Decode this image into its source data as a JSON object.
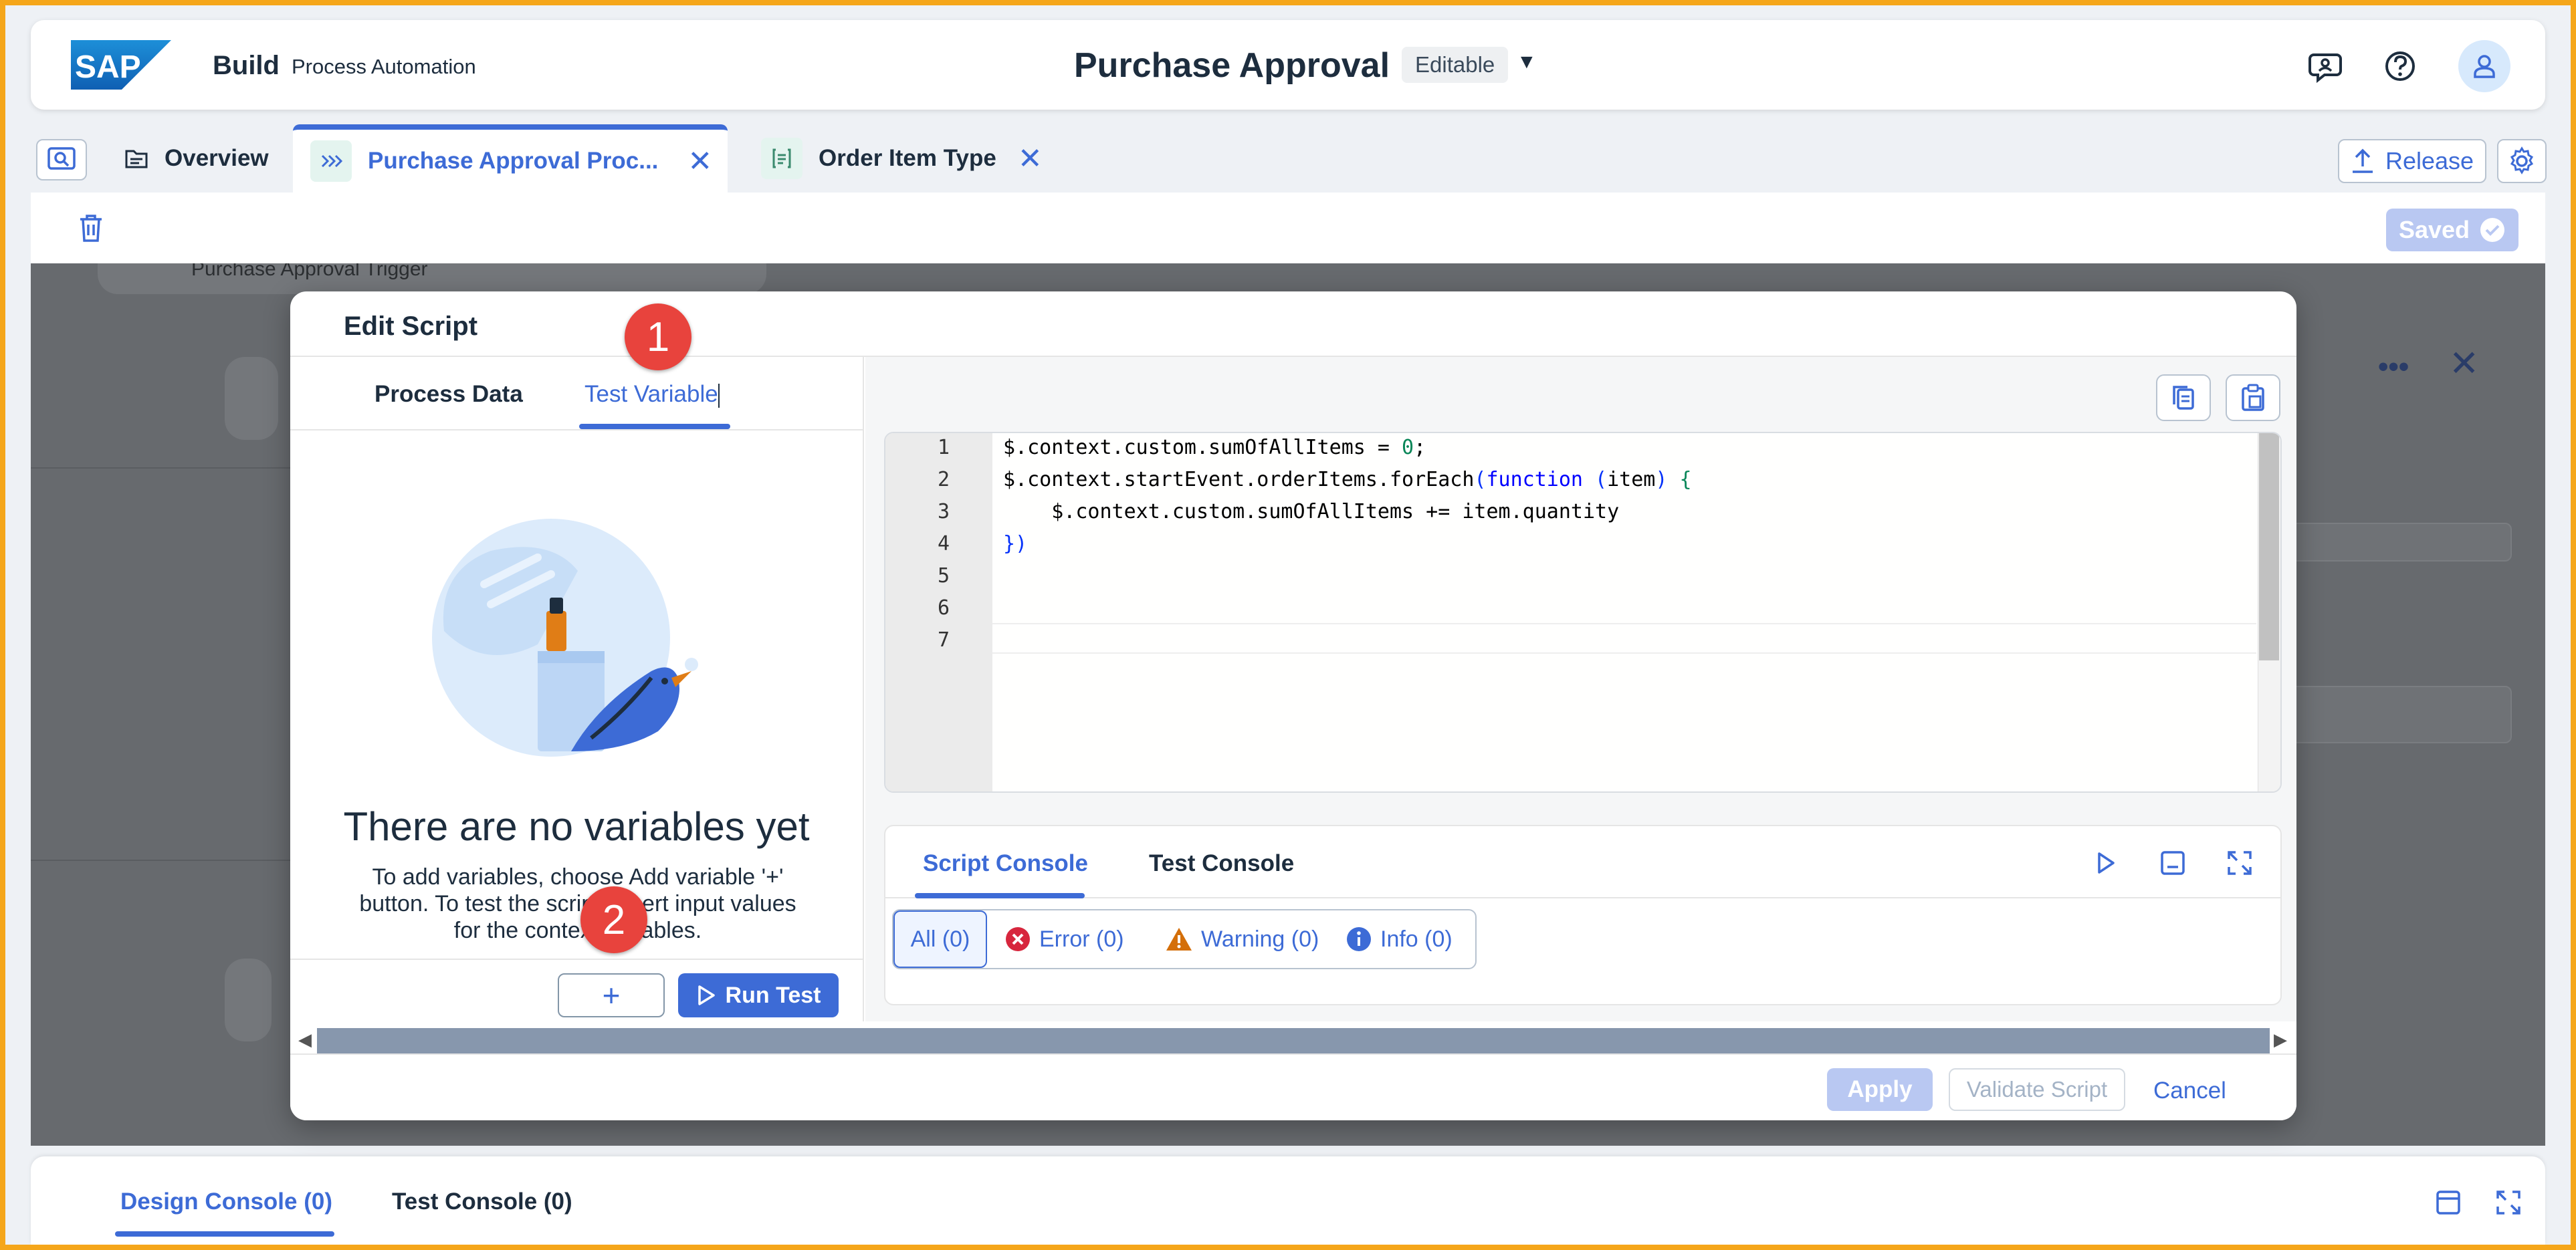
{
  "shell": {
    "brand": "SAP",
    "app_name": "Build",
    "app_sub": "Process Automation",
    "doc_title": "Purchase Approval",
    "status": "Editable"
  },
  "tabs": [
    {
      "label": "Overview"
    },
    {
      "label": "Purchase Approval Proc..."
    },
    {
      "label": "Order Item Type"
    }
  ],
  "toolbar": {
    "release_label": "Release",
    "saved_label": "Saved"
  },
  "canvas": {
    "trigger_label": "Purchase Approval Trigger"
  },
  "dialog": {
    "title": "Edit Script",
    "left_tabs": [
      "Process Data",
      "Test Variable"
    ],
    "empty_title": "There are no variables yet",
    "empty_desc": "To add variables, choose Add variable '+' button. To test the script, insert input values for the context variables.",
    "add_label": "+",
    "run_label": "Run Test",
    "code": {
      "line_numbers": [
        "1",
        "2",
        "3",
        "4",
        "5",
        "6",
        "7"
      ],
      "l1a": "$.context.custom.sumOfAllItems = ",
      "l1b": "0",
      "l1c": ";",
      "l2a": "$.context.startEvent.orderItems.forEach",
      "l2b": "(",
      "l2c": "function",
      "l2d": " ",
      "l2e": "(",
      "l2f": "item",
      "l2g": ")",
      "l2h": " {",
      "l3": "    $.context.custom.sumOfAllItems += item.quantity",
      "l4": "})"
    },
    "console_tabs": [
      "Script Console",
      "Test Console"
    ],
    "filters": [
      "All (0)",
      "Error (0)",
      "Warning (0)",
      "Info (0)"
    ],
    "apply_label": "Apply",
    "validate_label": "Validate Script",
    "cancel_label": "Cancel"
  },
  "callouts": [
    "1",
    "2"
  ],
  "bottom": {
    "tabs": [
      "Design Console (0)",
      "Test Console (0)"
    ]
  },
  "colors": {
    "accent": "#3d6bd6",
    "frame": "#f5a61a",
    "callout": "#e8433d"
  }
}
